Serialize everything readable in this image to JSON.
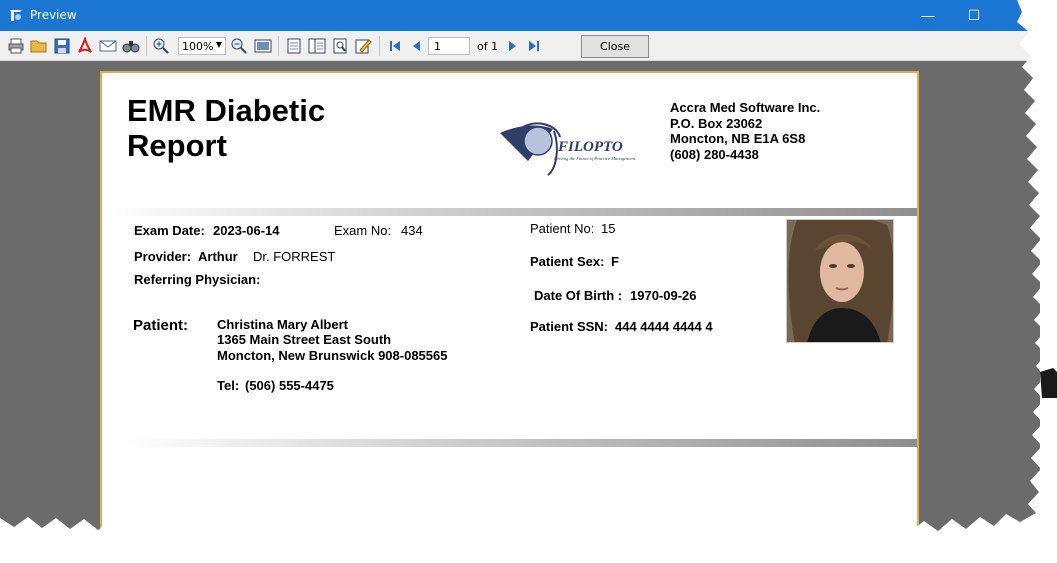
{
  "window": {
    "title": "Preview",
    "minimize_glyph": "—",
    "maximize_glyph": "☐"
  },
  "toolbar": {
    "icons": [
      "print-icon",
      "open-folder-icon",
      "save-icon",
      "pdf-icon",
      "email-icon",
      "find-icon",
      "zoom-in-icon",
      "zoom-out-icon",
      "full-page-icon",
      "single-page-icon",
      "multi-page-icon",
      "search-doc-icon",
      "edit-icon",
      "first-page-icon",
      "prev-page-icon",
      "next-page-icon",
      "last-page-icon"
    ],
    "zoom_value": "100%",
    "page_number": "1",
    "page_of": "of 1",
    "close_label": "Close"
  },
  "report": {
    "title": "EMR Diabetic Report",
    "logo_text": "FILOPTO",
    "logo_tagline": "Driving the Future of Practice Management",
    "company": {
      "name": "Accra Med Software Inc.",
      "address1": "P.O. Box 23062",
      "address2": "Moncton,  NB E1A 6S8",
      "phone": "(608) 280-4438"
    },
    "exam_date_label": "Exam Date:",
    "exam_date": "2023-06-14",
    "exam_no_label": "Exam No:",
    "exam_no": "434",
    "patient_no_label": "Patient No:",
    "patient_no": "15",
    "provider_label": "Provider:",
    "provider_first": "Arthur",
    "provider_last": "Dr. FORREST",
    "referring_label": "Referring Physician:",
    "referring": "",
    "patient_sex_label": "Patient Sex:",
    "patient_sex": "F",
    "dob_label": "Date Of Birth :",
    "dob": "1970-09-26",
    "patient_label": "Patient:",
    "patient_name": "Christina  Mary  Albert",
    "patient_address1": "1365 Main Street East South",
    "patient_address2": "Moncton, New Brunswick  908-085565",
    "patient_tel_label": "Tel:",
    "patient_tel": "(506) 555-4475",
    "ssn_label": "Patient SSN:",
    "ssn": "444 4444 4444 4"
  },
  "colors": {
    "titlebar": "#1a76d2",
    "viewer_bg": "#6b6b6b",
    "page_border": "#d8b150"
  }
}
